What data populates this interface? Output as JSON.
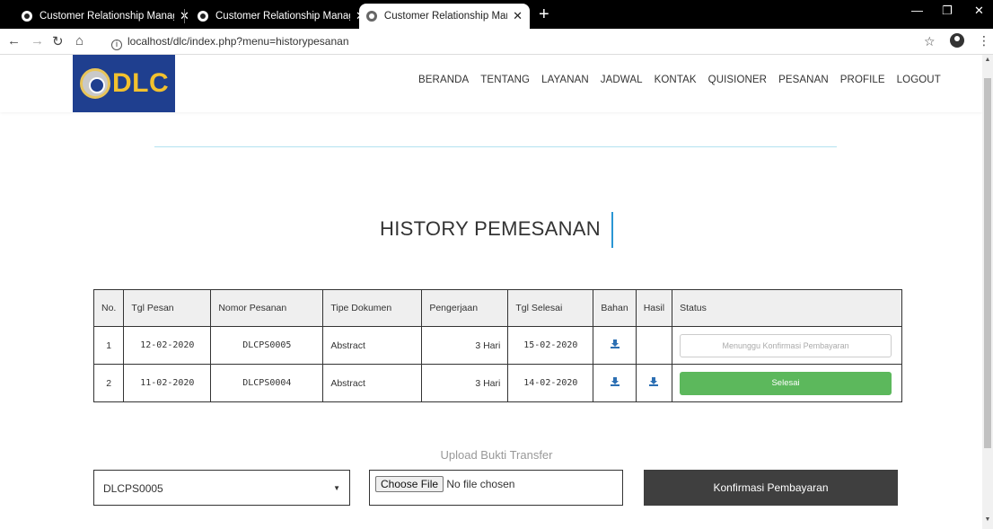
{
  "browser": {
    "tabs": [
      {
        "title": "Customer Relationship Managem"
      },
      {
        "title": "Customer Relationship Managem"
      },
      {
        "title": "Customer Relationship Managem"
      }
    ],
    "url": "localhost/dlc/index.php?menu=historypesanan"
  },
  "header": {
    "logo_text": "DLC",
    "menu": [
      "BERANDA",
      "TENTANG",
      "LAYANAN",
      "JADWAL",
      "KONTAK",
      "QUISIONER",
      "PESANAN",
      "PROFILE",
      "LOGOUT"
    ]
  },
  "page_title": "HISTORY PEMESANAN",
  "table": {
    "columns": [
      "No.",
      "Tgl Pesan",
      "Nomor Pesanan",
      "Tipe Dokumen",
      "Pengerjaan",
      "Tgl Selesai",
      "Bahan",
      "Hasil",
      "Status"
    ],
    "rows": [
      {
        "no": "1",
        "tgl_pesan": "12-02-2020",
        "nomor": "DLCPS0005",
        "tipe": "Abstract",
        "pengerjaan": "3 Hari",
        "tgl_selesai": "15-02-2020",
        "bahan": "download-icon",
        "hasil": "",
        "status": "Menunggu Konfirmasi Pembayaran"
      },
      {
        "no": "2",
        "tgl_pesan": "11-02-2020",
        "nomor": "DLCPS0004",
        "tipe": "Abstract",
        "pengerjaan": "3 Hari",
        "tgl_selesai": "14-02-2020",
        "bahan": "download-icon",
        "hasil": "download-icon",
        "status": "Selesai"
      }
    ]
  },
  "upload": {
    "title": "Upload Bukti Transfer",
    "selected_order": "DLCPS0005",
    "file_button": "Choose File",
    "file_status": "No file chosen",
    "submit_label": "Konfirmasi Pembayaran"
  },
  "colors": {
    "logo_bg": "#1f3f8f",
    "logo_text": "#f2c12e",
    "status_done": "#5cb85c",
    "submit_bg": "#3f3f3f",
    "accent_bar": "#2a96d4"
  }
}
